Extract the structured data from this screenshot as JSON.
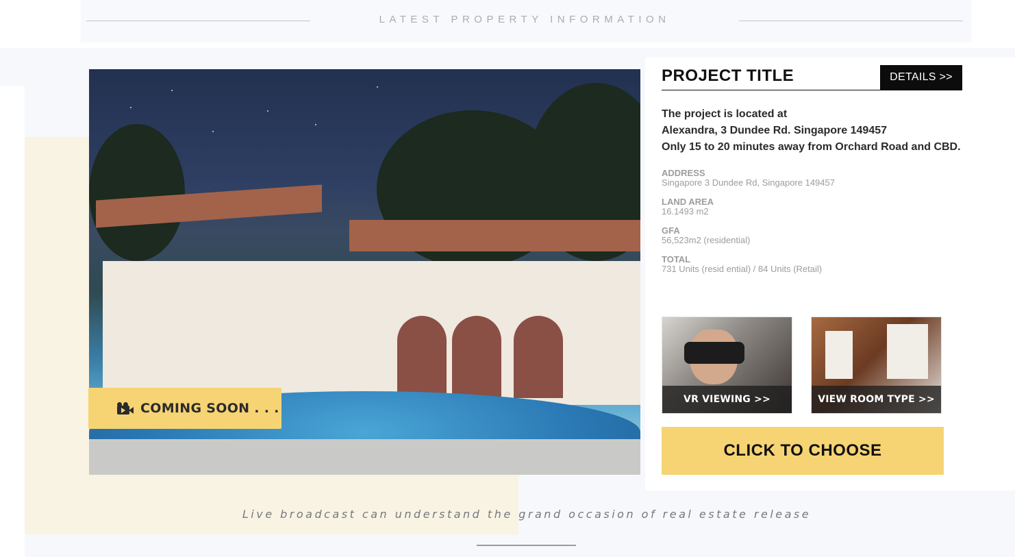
{
  "header": {
    "title": "LATEST PROPERTY INFORMATION"
  },
  "hero": {
    "coming_soon_label": "COMING SOON . . ."
  },
  "project": {
    "title": "PROJECT TITLE",
    "details_label": "DETAILS >>",
    "intro_lines": [
      "The project is located at",
      "Alexandra, 3 Dundee Rd. Singapore 149457",
      "Only 15 to 20 minutes away from Orchard Road and  CBD."
    ],
    "specs": [
      {
        "label": "ADDRESS",
        "value": "Singapore 3 Dundee Rd, Singapore 149457"
      },
      {
        "label": "LAND AREA",
        "value": "16.1493 m2"
      },
      {
        "label": "GFA",
        "value": "56,523m2 (residential)"
      },
      {
        "label": "TOTAL",
        "value": "731 Units (resid ential) / 84 Units (Retail)"
      }
    ]
  },
  "thumbs": {
    "vr_label": "VR VIEWING  >>",
    "room_label": "VIEW ROOM TYPE  >>"
  },
  "cta": {
    "label": "CLICK TO CHOOSE"
  },
  "footer": {
    "tagline": "Live broadcast can understand the grand occasion of real estate release"
  },
  "colors": {
    "accent": "#f6d473",
    "dark": "#0c0c0c",
    "cream": "#f8f3e3"
  },
  "icons": [
    "video-camera-icon"
  ]
}
